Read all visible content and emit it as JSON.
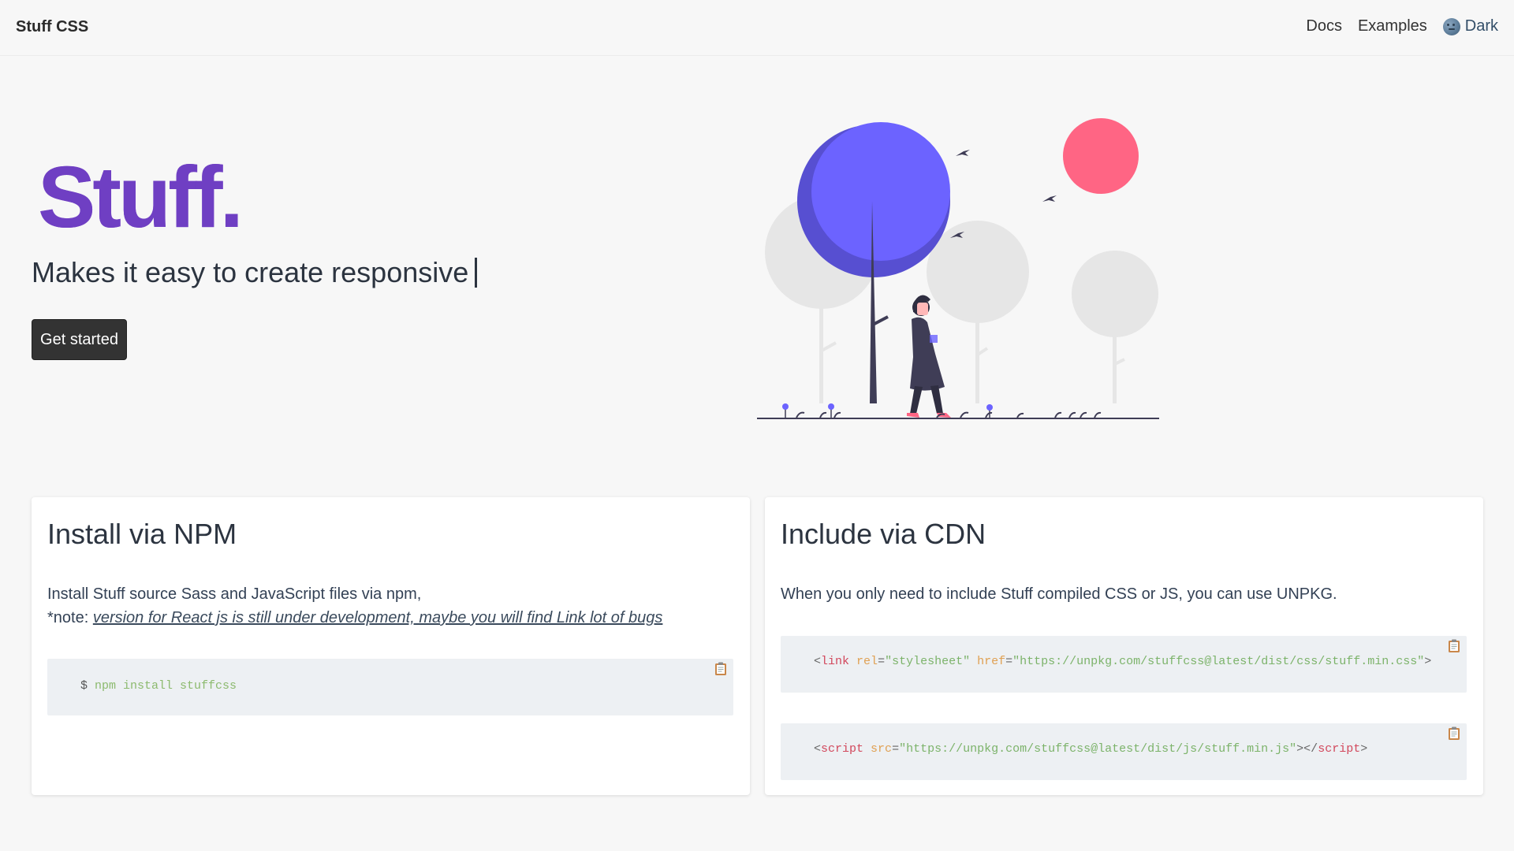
{
  "navbar": {
    "brand": "Stuff CSS",
    "links": [
      "Docs",
      "Examples"
    ],
    "theme_label": "Dark"
  },
  "hero": {
    "title": "Stuff.",
    "subtitle": "Makes it easy to create responsive",
    "button_label": "Get started"
  },
  "npm_card": {
    "title": "Install via NPM",
    "text_line1": "Install Stuff source Sass and JavaScript files via npm,",
    "note_prefix": "*note: ",
    "note_link": "version for React js is still under development, maybe you will find Link lot of bugs",
    "code_prompt": "$",
    "code_cmd": "npm install stuffcss"
  },
  "cdn_card": {
    "title": "Include via CDN",
    "text": "When you only need to include Stuff compiled CSS or JS, you can use UNPKG.",
    "link_code": {
      "open": "<",
      "tag": "link",
      "attr1": "rel",
      "val1": "\"stylesheet\"",
      "attr2": "href",
      "val2": "\"https://unpkg.com/stuffcss@latest/dist/css/stuff.min.css\"",
      "close": ">"
    },
    "script_code": {
      "open": "<",
      "tag": "script",
      "attr1": "src",
      "val1": "\"https://unpkg.com/stuffcss@latest/dist/js/stuff.min.js\"",
      "mid": "></",
      "close_tag": "script",
      "close": ">"
    }
  },
  "colors": {
    "brand_purple": "#6f3fc3",
    "tree_blue": "#6c63ff",
    "sun_pink": "#ff6584"
  }
}
